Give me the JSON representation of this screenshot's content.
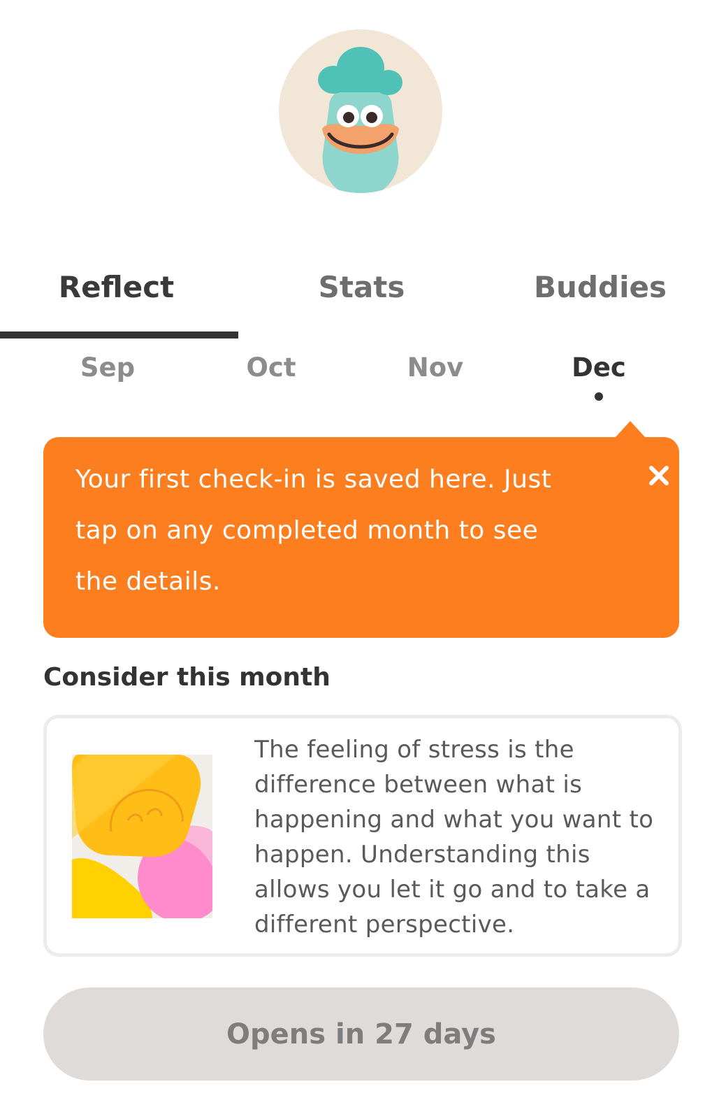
{
  "avatar": {
    "icon": "smiling-blue-character-icon",
    "background_color": "#f2e6d6"
  },
  "tabs": [
    {
      "label": "Reflect",
      "active": true
    },
    {
      "label": "Stats",
      "active": false
    },
    {
      "label": "Buddies",
      "active": false
    }
  ],
  "months": [
    {
      "label": "Sep",
      "active": false
    },
    {
      "label": "Oct",
      "active": false
    },
    {
      "label": "Nov",
      "active": false
    },
    {
      "label": "Dec",
      "active": true
    }
  ],
  "tooltip": {
    "text": "Your first check-in is saved here. Just tap on any completed month to see the details.",
    "close_icon": "close-icon",
    "color": "#fd7e1f"
  },
  "consider": {
    "heading": "Consider this month",
    "body": "The feeling of stress is the difference between what is happening and what you want to happen.  Understanding this allows you let it go and to take a different perspective.",
    "illustration_icon": "smiling-shapes-illustration"
  },
  "cta": {
    "label": "Opens in 27 days",
    "color": "#dedbd8"
  }
}
